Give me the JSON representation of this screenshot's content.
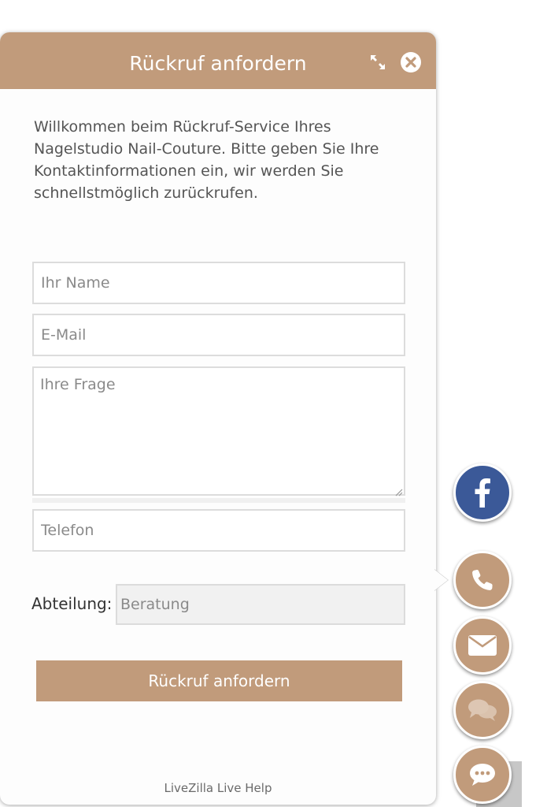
{
  "panel": {
    "title": "Rückruf anfordern",
    "expand_icon": "expand-icon",
    "close_icon": "close-circle-icon",
    "intro": "Willkommen beim Rückruf-Service Ihres Nagelstudio Nail-Couture. Bitte geben Sie Ihre Kontaktinformationen ein, wir werden Sie schnellstmöglich zurückrufen.",
    "header_color": "#c19b7b"
  },
  "form": {
    "name": {
      "value": "",
      "placeholder": "Ihr Name"
    },
    "email": {
      "value": "",
      "placeholder": "E-Mail"
    },
    "question": {
      "value": "",
      "placeholder": "Ihre Frage"
    },
    "phone": {
      "value": "",
      "placeholder": "Telefon"
    },
    "department": {
      "label": "Abteilung:",
      "selected": "Beratung"
    },
    "submit_label": "Rückruf anfordern"
  },
  "footer": {
    "text": "LiveZilla Live Help"
  },
  "side_buttons": [
    {
      "name": "facebook",
      "icon": "facebook-icon",
      "color": "#3b5998"
    },
    {
      "name": "phone",
      "icon": "phone-icon",
      "color": "#c19b7b",
      "active": true
    },
    {
      "name": "email",
      "icon": "envelope-icon",
      "color": "#c19b7b"
    },
    {
      "name": "chat",
      "icon": "chat-bubbles-icon",
      "color": "#c19b7b"
    },
    {
      "name": "livechat",
      "icon": "speech-bubble-icon",
      "color": "#c19b7b"
    }
  ]
}
